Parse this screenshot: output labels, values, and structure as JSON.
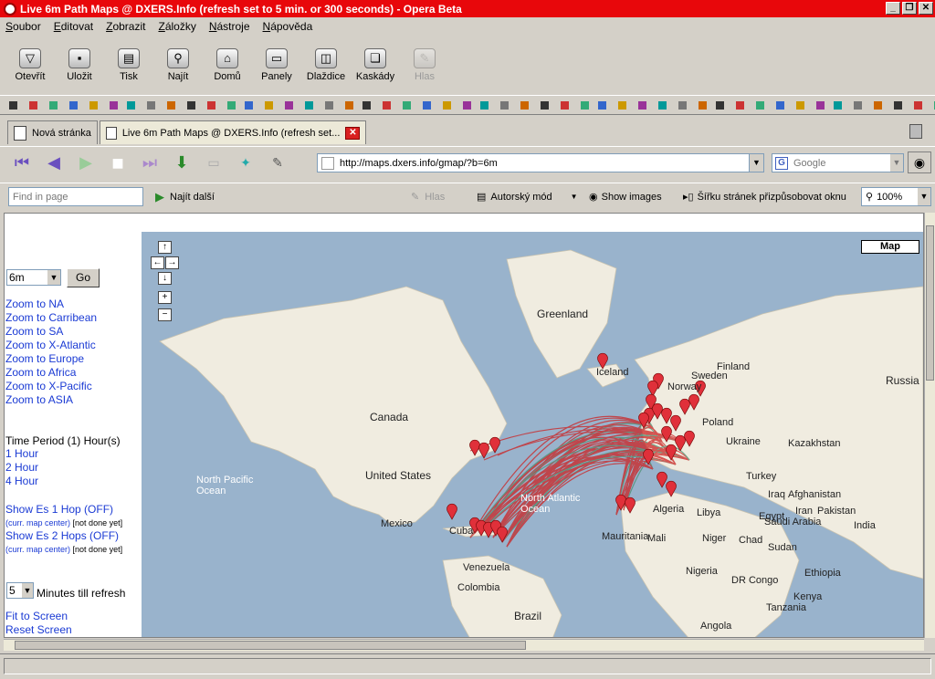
{
  "window": {
    "title": "Live 6m Path Maps @ DXERS.Info (refresh set to 5 min. or 300 seconds) - Opera Beta"
  },
  "menu": [
    "Soubor",
    "Editovat",
    "Zobrazit",
    "Záložky",
    "Nástroje",
    "Nápověda"
  ],
  "toolbar": [
    {
      "label": "Otevřít",
      "icon": "open-icon"
    },
    {
      "label": "Uložit",
      "icon": "save-icon"
    },
    {
      "label": "Tisk",
      "icon": "print-icon"
    },
    {
      "label": "Najít",
      "icon": "find-icon"
    },
    {
      "label": "Domů",
      "icon": "home-icon"
    },
    {
      "label": "Panely",
      "icon": "panels-icon"
    },
    {
      "label": "Dlaždice",
      "icon": "tile-icon"
    },
    {
      "label": "Kaskády",
      "icon": "cascade-icon"
    },
    {
      "label": "Hlas",
      "icon": "voice-icon",
      "disabled": true
    }
  ],
  "tabs": [
    {
      "label": "Nová stránka",
      "active": false
    },
    {
      "label": "Live 6m Path Maps @ DXERS.Info (refresh set...",
      "active": true
    }
  ],
  "address": {
    "url": "http://maps.dxers.info/gmap/?b=6m",
    "search_placeholder": "Google"
  },
  "findbar": {
    "placeholder": "Find in page",
    "find_next": "Najít další",
    "voice": "Hlas",
    "author_mode": "Autorský mód",
    "show_images": "Show images",
    "fit_width": "Šířku stránek přizpůsobovat oknu",
    "zoom": "100%"
  },
  "sidebar": {
    "band": "6m",
    "go": "Go",
    "zoom_links": [
      "Zoom to NA",
      "Zoom to Carribean",
      "Zoom to SA",
      "Zoom to X-Atlantic",
      "Zoom to Europe",
      "Zoom to Africa",
      "Zoom to X-Pacific",
      "Zoom to ASIA"
    ],
    "time_period": "Time Period (1) Hour(s)",
    "hour_links": [
      "1 Hour",
      "2 Hour",
      "4 Hour"
    ],
    "es1": "Show Es 1 Hop (OFF)",
    "es1_note": "(curr. map center)",
    "es1_note2": "[not done yet]",
    "es2": "Show Es 2 Hops (OFF)",
    "es2_note": "(curr. map center)",
    "es2_note2": "[not done yet]",
    "minutes": "5",
    "minutes_label": "Minutes till refresh",
    "fit": "Fit to Screen",
    "reset": "Reset Screen"
  },
  "map": {
    "type_button": "Map",
    "labels": [
      "Greenland",
      "Iceland",
      "Finland",
      "Sweden",
      "Norway",
      "Russia",
      "Canada",
      "Poland",
      "Ukraine",
      "Kazakhstan",
      "United States",
      "Turkey",
      "Iraq",
      "Afghanistan",
      "North Pacific Ocean",
      "North Atlantic Ocean",
      "Iran",
      "Pakistan",
      "Mexico",
      "Algeria",
      "Libya",
      "Egypt",
      "Saudi Arabia",
      "India",
      "Cuba",
      "Mauritania",
      "Mali",
      "Niger",
      "Chad",
      "Sudan",
      "Venezuela",
      "Colombia",
      "Nigeria",
      "Ethiopia",
      "DR Congo",
      "Kenya",
      "Tanzania",
      "Brazil",
      "Angola"
    ],
    "colors": {
      "land": "#f0ece0",
      "water": "#99b3cc",
      "path_red": "#cc2222",
      "path_green": "#4a9070",
      "marker": "#e0303a"
    }
  }
}
